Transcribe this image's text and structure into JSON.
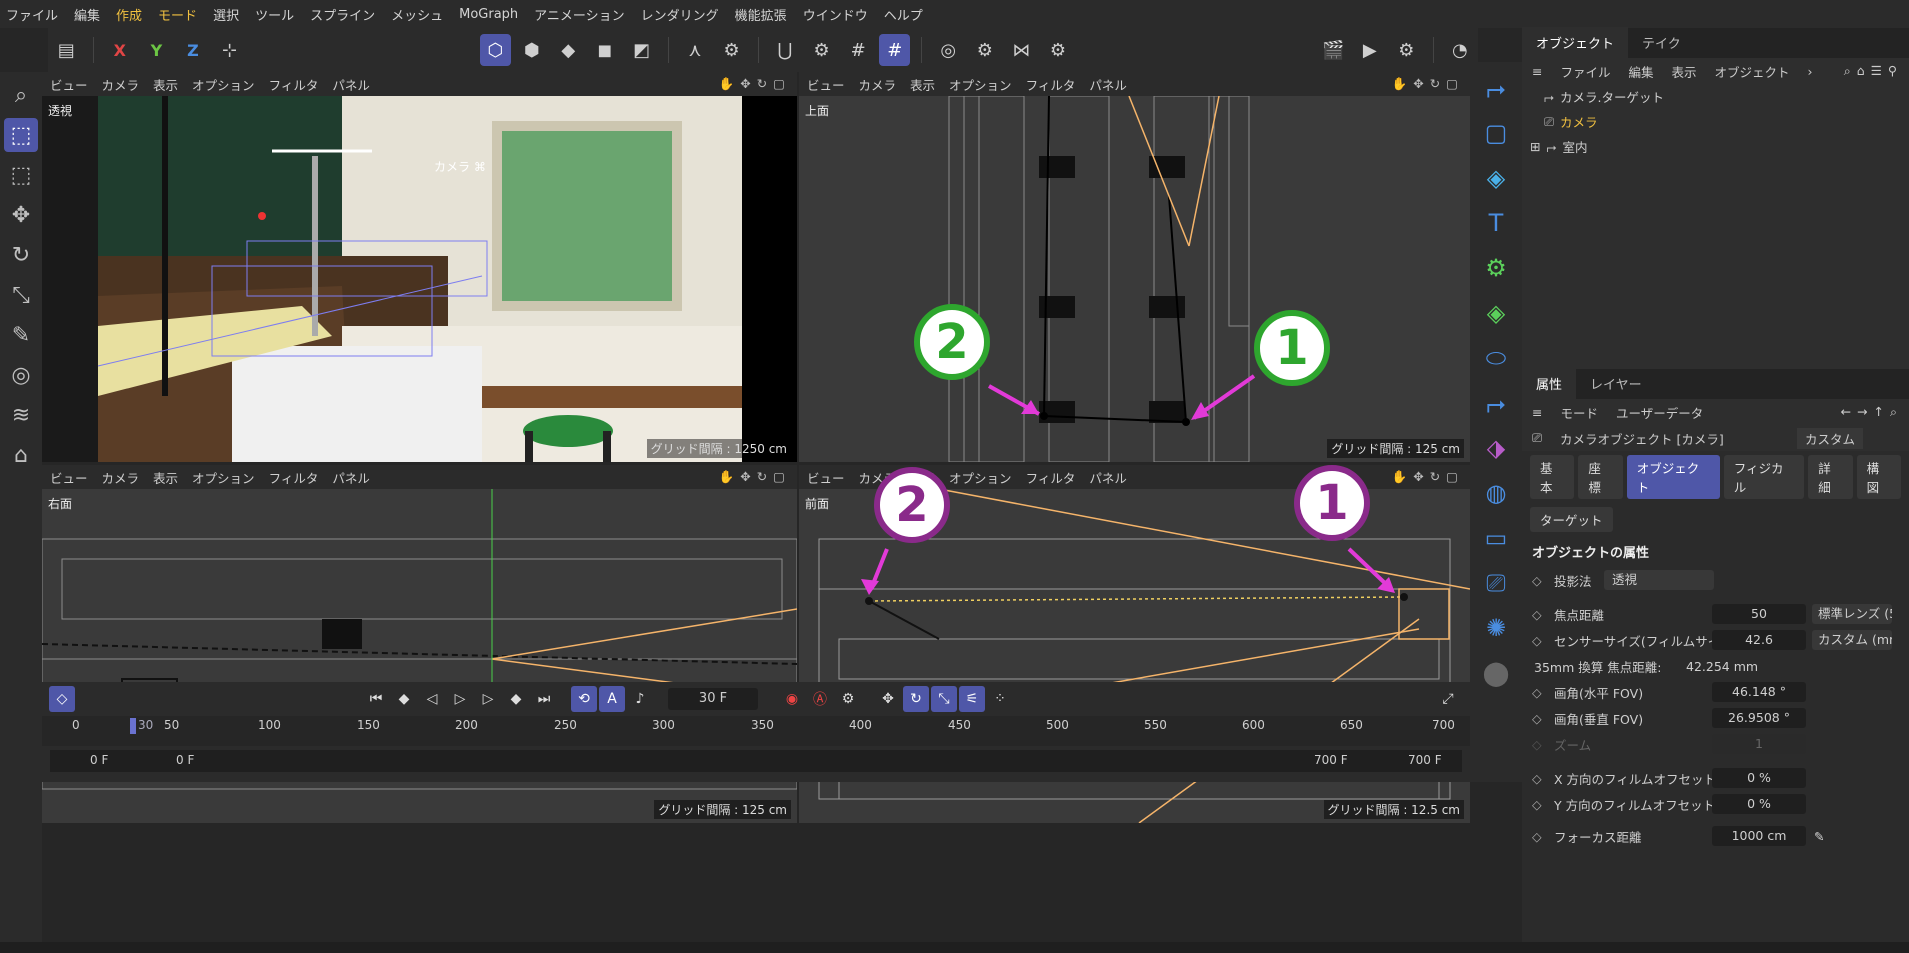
{
  "menu": [
    "ファイル",
    "編集",
    "作成",
    "モード",
    "選択",
    "ツール",
    "スプライン",
    "メッシュ",
    "MoGraph",
    "アニメーション",
    "レンダリング",
    "機能拡張",
    "ウインドウ",
    "ヘルプ"
  ],
  "viewport_menu": [
    "ビュー",
    "カメラ",
    "表示",
    "オプション",
    "フィルタ",
    "パネル"
  ],
  "axes": {
    "x": "X",
    "y": "Y",
    "z": "Z"
  },
  "vp_tl": {
    "label": "透視",
    "camera": "カメラ ⌘",
    "grid": ""
  },
  "vp_tr": {
    "label": "上面",
    "grid": "グリッド間隔 : 125 cm"
  },
  "vp_bl": {
    "label": "右面",
    "grid": "グリッド間隔 : 125 cm"
  },
  "vp_br": {
    "label": "前面",
    "grid": "グリッド間隔 : 12.5 cm"
  },
  "vp_tl_grid": "グリッド間隔 : 1250 cm",
  "markers": {
    "one": "1",
    "two": "2"
  },
  "objects_panel": {
    "tabs": [
      "オブジェクト",
      "テイク"
    ],
    "menu": [
      "ファイル",
      "編集",
      "表示",
      "オブジェクト"
    ],
    "items": [
      {
        "name": "カメラ.ターゲット"
      },
      {
        "name": "カメラ",
        "selected": true
      },
      {
        "name": "室内"
      }
    ]
  },
  "attr_panel": {
    "tabs": [
      "属性",
      "レイヤー"
    ],
    "menu": [
      "モード",
      "ユーザーデータ"
    ],
    "title": "カメラオブジェクト [カメラ]",
    "preset": "カスタム",
    "subtabs": [
      "基本",
      "座標",
      "オブジェクト",
      "フィジカル",
      "詳細",
      "構図"
    ],
    "subtab2": "ターゲット",
    "section": "オブジェクトの属性",
    "projection_label": "投影法",
    "projection_value": "透視",
    "rows": [
      {
        "label": "焦点距離",
        "value": "50",
        "extra": "標準レンズ (5"
      },
      {
        "label": "センサーサイズ(フィルムサイズ)",
        "value": "42.6",
        "extra": "カスタム (mm"
      },
      {
        "label": "35mm 換算 焦点距離:",
        "value": "42.254 mm"
      },
      {
        "label": "画角(水平 FOV)",
        "value": "46.148 °"
      },
      {
        "label": "画角(垂直 FOV)",
        "value": "26.9508 °"
      },
      {
        "label": "ズーム",
        "value": "1"
      },
      {
        "label": "X 方向のフィルムオフセット",
        "value": "0 %"
      },
      {
        "label": "Y 方向のフィルムオフセット",
        "value": "0 %"
      },
      {
        "label": "フォーカス距離",
        "value": "1000 cm"
      }
    ]
  },
  "timeline": {
    "frame": "30 F",
    "ruler": [
      "0",
      "50",
      "100",
      "150",
      "200",
      "250",
      "300",
      "350",
      "400",
      "450",
      "500",
      "550",
      "600",
      "650",
      "700"
    ],
    "current": "30",
    "start": "0 F",
    "min": "0 F",
    "max": "700 F",
    "end": "700 F"
  },
  "colors": {
    "accent": "#4f57a8",
    "marker_green": "#2ea62e",
    "marker_purple": "#8a2a8a",
    "arrow": "#e23ad8"
  }
}
